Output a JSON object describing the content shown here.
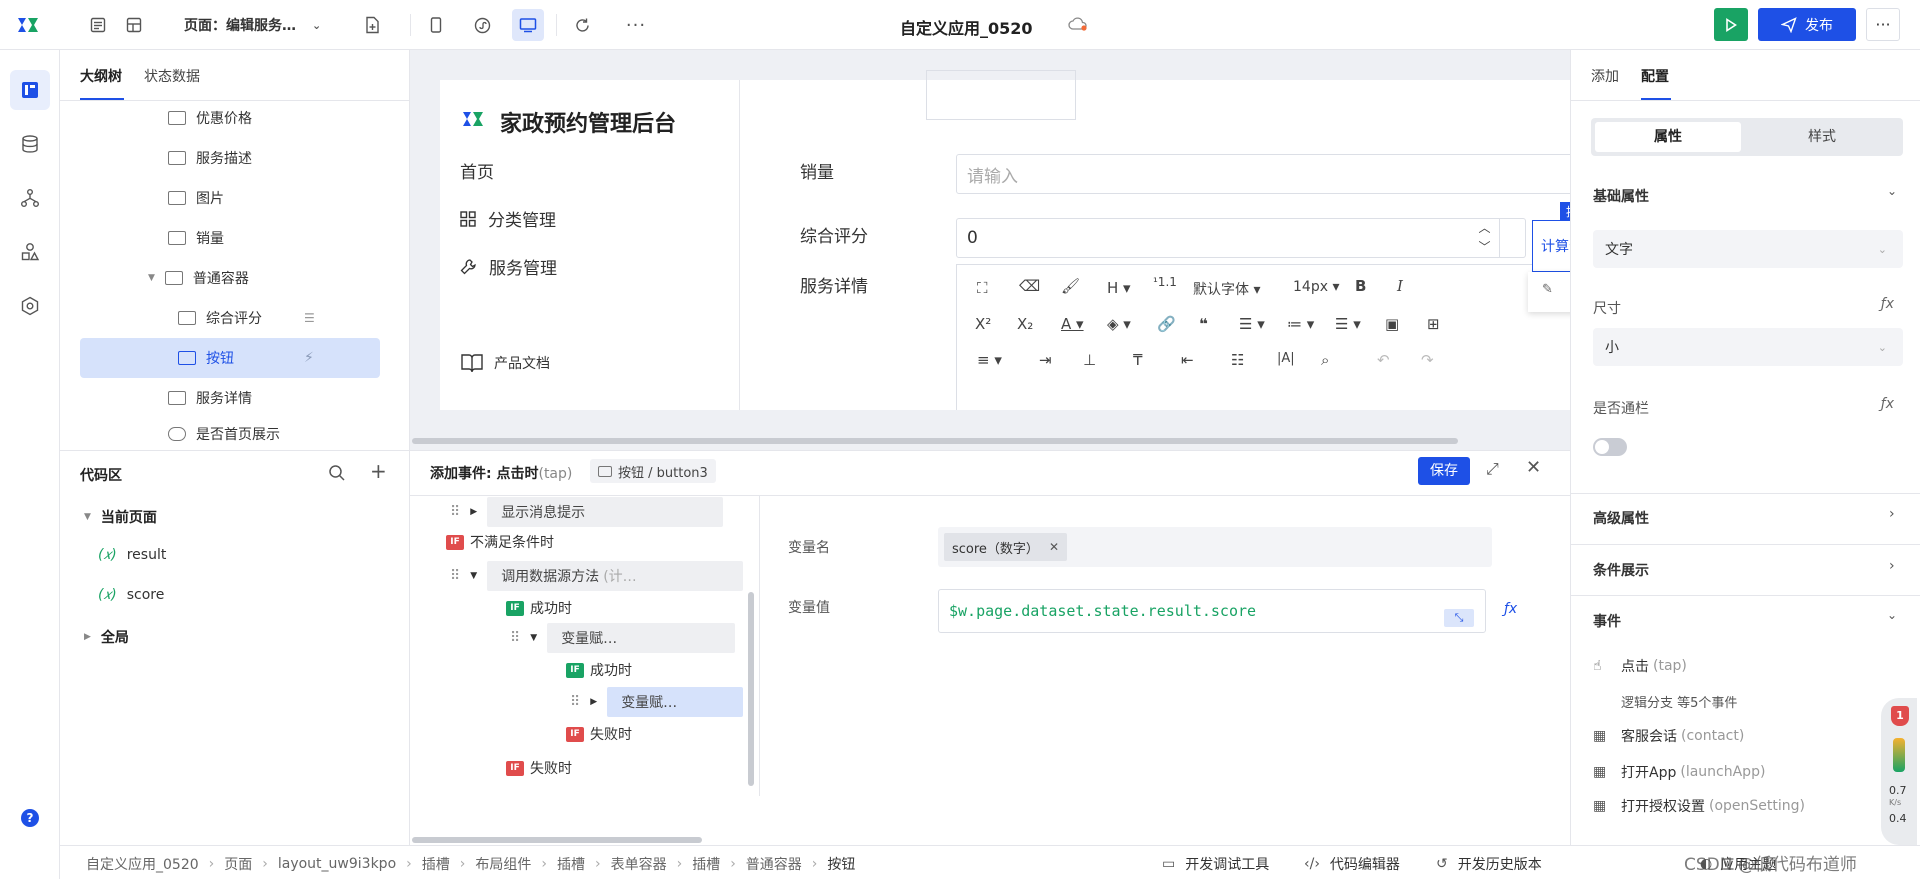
{
  "topbar": {
    "page_label": "页面：编辑服务…",
    "app_title": "自定义应用_0520",
    "publish_label": "发布"
  },
  "outline": {
    "tabs": [
      "大纲树",
      "状态数据"
    ],
    "items": [
      {
        "label": "优惠价格",
        "indent": 1
      },
      {
        "label": "服务描述",
        "indent": 1
      },
      {
        "label": "图片",
        "indent": 1
      },
      {
        "label": "销量",
        "indent": 1
      },
      {
        "label": "普通容器",
        "indent": 1
      },
      {
        "label": "综合评分",
        "indent": 2
      },
      {
        "label": "按钮",
        "indent": 2
      },
      {
        "label": "服务详情",
        "indent": 1
      },
      {
        "label": "是否首页展示",
        "indent": 1
      }
    ]
  },
  "code": {
    "title": "代码区",
    "current_page": "当前页面",
    "vars": [
      "result",
      "score"
    ],
    "global": "全局",
    "var_prefix": "(𝑥)"
  },
  "canvas": {
    "brand": "家政预约管理后台",
    "nav": [
      "首页",
      "分类管理",
      "服务管理"
    ],
    "doc_link": "产品文档",
    "fields": {
      "sales_label": "销量",
      "sales_placeholder": "请输入",
      "score_label": "综合评分",
      "score_value": "0",
      "detail_label": "服务详情"
    },
    "toolbar": {
      "font": "默认字体",
      "size": "14px"
    },
    "button_tag": "按钮",
    "calc_button": "计算分数"
  },
  "event": {
    "title": "添加事件: 点击时",
    "title_suffix": "(tap)",
    "target": "按钮 / button3",
    "save": "保存",
    "nodes": {
      "show_msg": "显示消息提示",
      "not_match": "不满足条件时",
      "call_ds": "调用数据源方法",
      "call_ds_suffix": "(计…",
      "success1": "成功时",
      "assign1": "变量赋…",
      "success2": "成功时",
      "assign2": "变量赋…",
      "fail2": "失败时",
      "fail1": "失败时"
    },
    "var_name_label": "变量名",
    "var_name_tag": "score（数字）",
    "var_value_label": "变量值",
    "var_value": "$w.page.dataset.state.result.score"
  },
  "right": {
    "tabs": [
      "添加",
      "配置"
    ],
    "seg": [
      "属性",
      "样式"
    ],
    "basic": "基础属性",
    "text_select": "文字",
    "size_label": "尺寸",
    "size_value": "小",
    "block_label": "是否通栏",
    "advanced": "高级属性",
    "condition": "条件展示",
    "events": "事件",
    "event_items": [
      {
        "label": "点击",
        "suffix": "(tap)"
      },
      {
        "label": "客服会话",
        "suffix": "(contact)"
      },
      {
        "label": "打开App",
        "suffix": "(launchApp)"
      },
      {
        "label": "打开授权设置",
        "suffix": "(openSetting)"
      }
    ],
    "branch": "逻辑分支 等5个事件",
    "badge_count": "1",
    "speed": "0.7",
    "speed_unit": "K/s",
    "speed2": "0.4"
  },
  "status": {
    "crumbs": [
      "自定义应用_0520",
      "页面",
      "layout_uw9i3kpo",
      "插槽",
      "布局组件",
      "插槽",
      "表单容器",
      "插槽",
      "普通容器",
      "按钮"
    ],
    "tools": [
      "开发调试工具",
      "代码编辑器",
      "开发历史版本"
    ],
    "watermark": "CSDN @低代码布道师",
    "theme": "应用主题"
  }
}
